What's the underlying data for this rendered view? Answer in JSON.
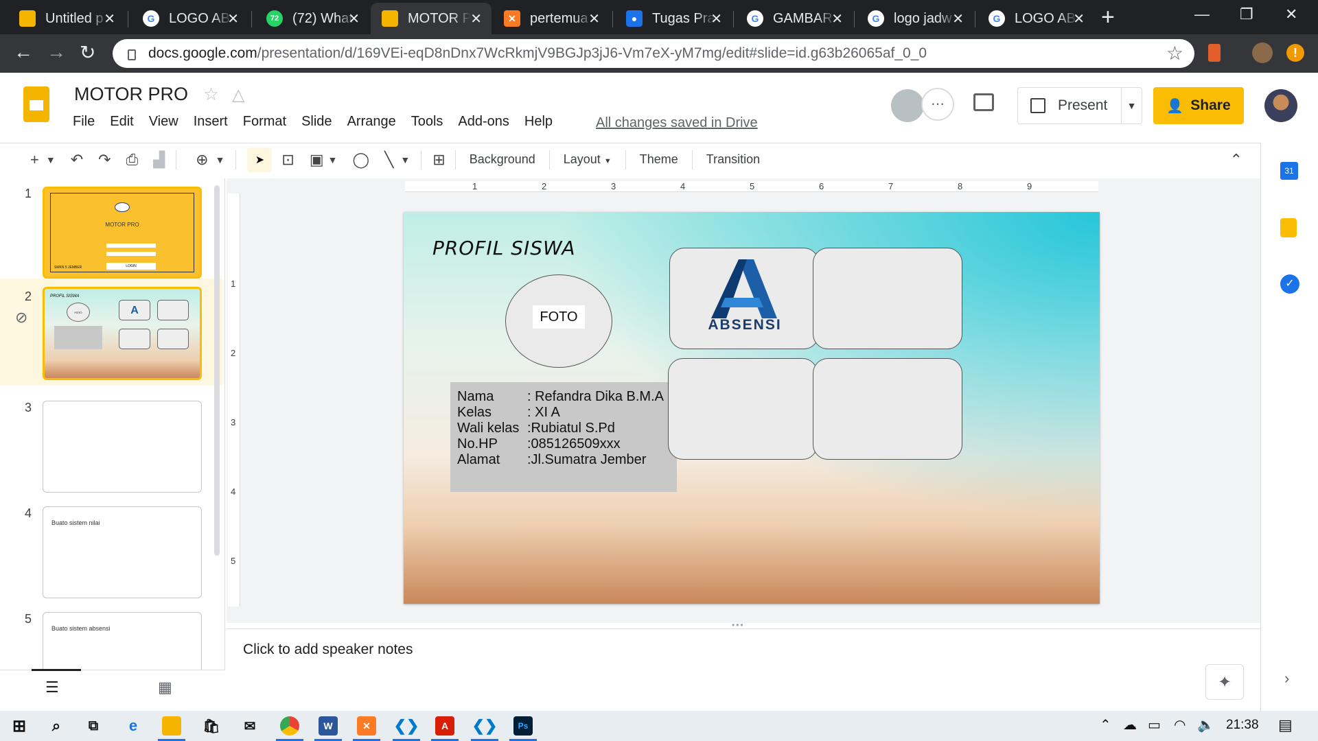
{
  "browser": {
    "tabs": [
      {
        "title": "Untitled p",
        "icon": "slides-icon",
        "color": "#f4b400"
      },
      {
        "title": "LOGO ABS",
        "icon": "google-icon",
        "color": "#ffffff"
      },
      {
        "title": "(72) What",
        "icon": "whatsapp-icon",
        "color": "#25d366",
        "badge": "72"
      },
      {
        "title": "MOTOR P",
        "icon": "slides-icon",
        "color": "#f4b400",
        "active": true
      },
      {
        "title": "pertemua",
        "icon": "xampp-icon",
        "color": "#fb7a24"
      },
      {
        "title": "Tugas Pra",
        "icon": "classroom-icon",
        "color": "#1a73e8"
      },
      {
        "title": "GAMBAR",
        "icon": "google-icon",
        "color": "#ffffff"
      },
      {
        "title": "logo jadw",
        "icon": "google-icon",
        "color": "#ffffff"
      },
      {
        "title": "LOGO AB",
        "icon": "google-icon",
        "color": "#ffffff"
      }
    ],
    "new_tab": "+",
    "url_domain": "docs.google.com",
    "url_path": "/presentation/d/169VEi-eqD8nDnx7WcRkmjV9BGJp3jJ6-Vm7eX-yM7mg/edit#slide=id.g63b26065af_0_0"
  },
  "doc": {
    "title": "MOTOR PRO",
    "menu": [
      "File",
      "Edit",
      "View",
      "Insert",
      "Format",
      "Slide",
      "Arrange",
      "Tools",
      "Add-ons",
      "Help"
    ],
    "saved_status": "All changes saved in Drive",
    "present_label": "Present",
    "share_label": "Share"
  },
  "toolbar": {
    "background": "Background",
    "layout": "Layout",
    "theme": "Theme",
    "transition": "Transition"
  },
  "ruler": {
    "h": [
      "1",
      "2",
      "3",
      "4",
      "5",
      "6",
      "7",
      "8",
      "9"
    ],
    "v": [
      "1",
      "2",
      "3",
      "4",
      "5"
    ]
  },
  "filmstrip": {
    "slides": [
      {
        "num": "1",
        "title": "MOTOR PRO",
        "footer": "SMKN 5 JEMBER",
        "btn": "LOGIN"
      },
      {
        "num": "2",
        "selected": true,
        "title": "PROFIL SISWA",
        "photo": "FOTO"
      },
      {
        "num": "3",
        "note": ""
      },
      {
        "num": "4",
        "note": "Buato sistem nilai"
      },
      {
        "num": "5",
        "note": "Buato sistem absensi"
      }
    ]
  },
  "slide": {
    "title": "PROFIL SISWA",
    "photo_label": "FOTO",
    "info": [
      {
        "key": "Nama",
        "value": ": Refandra Dika B.M.A"
      },
      {
        "key": "Kelas",
        "value": ": XI A"
      },
      {
        "key": "Wali kelas",
        "value": ":Rubiatul S.Pd"
      },
      {
        "key": "No.HP",
        "value": ":085126509xxx"
      },
      {
        "key": "Alamat",
        "value": ":Jl.Sumatra Jember"
      }
    ],
    "logo_text": "ABSENSI"
  },
  "notes": {
    "placeholder": "Click to add speaker notes"
  },
  "taskbar": {
    "time": "21:38"
  },
  "colors": {
    "accent": "#fbbc04",
    "slides_yellow": "#f4b400",
    "logo_blue": "#1c5fa8"
  }
}
